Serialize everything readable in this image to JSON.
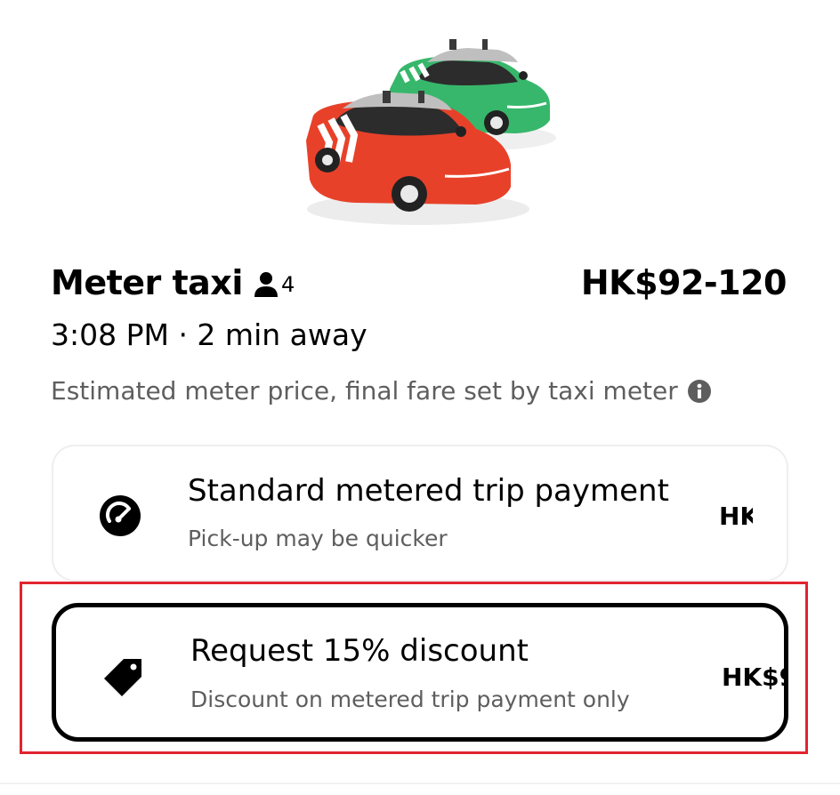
{
  "ride": {
    "name": "Meter taxi",
    "capacity": "4",
    "price_range": "HK$92-120",
    "eta": "3:08 PM · 2 min away",
    "note": "Estimated meter price, final fare set by taxi meter"
  },
  "options": {
    "standard": {
      "title": "Standard metered trip payment",
      "description": "Pick-up may be quicker",
      "price_visible": "HK",
      "icon": "meter-gauge-icon"
    },
    "discount": {
      "title": "Request 15% discount",
      "description": "Discount on metered trip payment only",
      "price_visible": "HK$9",
      "icon": "price-tag-icon",
      "selected": true
    }
  },
  "icons": {
    "capacity": "person-icon",
    "info": "info-icon"
  },
  "colors": {
    "highlight": "#e1242f",
    "taxi_red": "#e8412a",
    "taxi_green": "#37b76b",
    "secondary_text": "#5e5e5e"
  }
}
